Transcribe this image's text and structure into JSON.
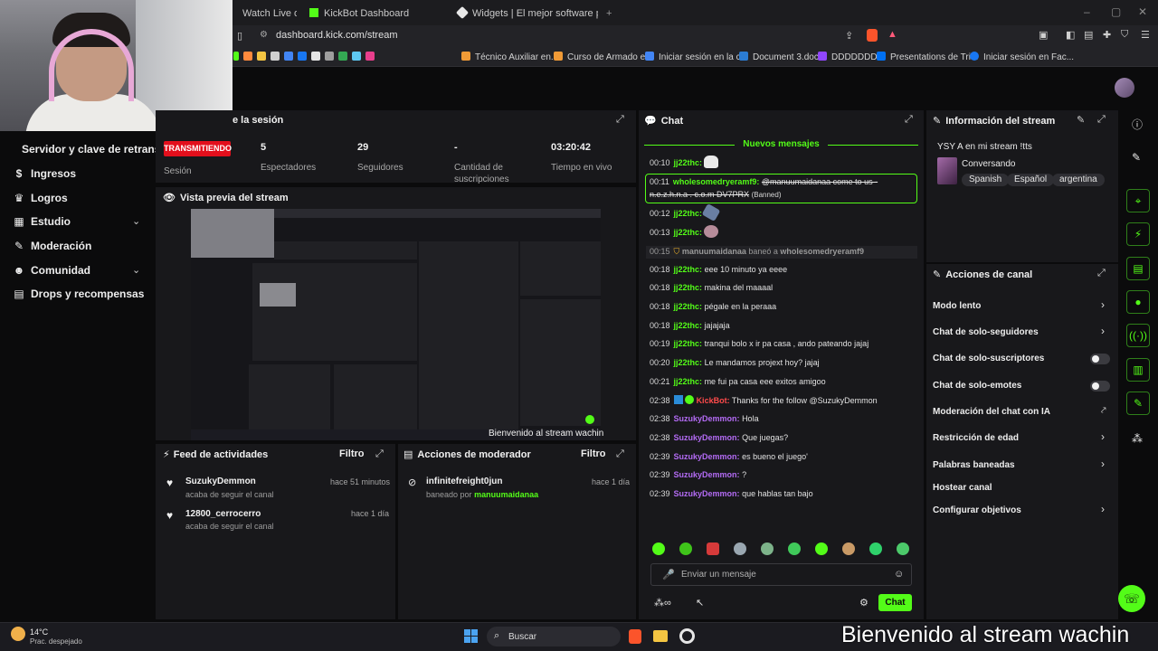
{
  "browser": {
    "tabs": [
      {
        "label": "Watch Live on"
      },
      {
        "label": "KickBot Dashboard"
      },
      {
        "label": "Widgets | El mejor software para pot"
      }
    ],
    "url": "dashboard.kick.com/stream",
    "bookmarks": [
      "Técnico Auxiliar en...",
      "Curso de Armado e...",
      "Iniciar sesión en la c...",
      "Document 3.docx",
      "DDDDDDD",
      "Presentations de Tri...",
      "Iniciar sesión en Fac..."
    ]
  },
  "sidebar": {
    "top_label": "Servidor y clave de retransm",
    "items": [
      {
        "label": "Ingresos",
        "icon": "dollar-icon"
      },
      {
        "label": "Logros",
        "icon": "trophy-icon"
      },
      {
        "label": "Estudio",
        "icon": "studio-icon"
      },
      {
        "label": "Moderación",
        "icon": "wrench-icon"
      },
      {
        "label": "Comunidad",
        "icon": "community-icon"
      },
      {
        "label": "Drops y recompensas",
        "icon": "drops-icon"
      }
    ]
  },
  "session": {
    "title": "e la sesión",
    "badge": "TRANSMITIENDO",
    "status_label": "Sesión",
    "stats": [
      {
        "value": "5",
        "label": "Espectadores"
      },
      {
        "value": "29",
        "label": "Seguidores"
      },
      {
        "value": "-",
        "label": "Cantidad de suscripciones"
      },
      {
        "value": "03:20:42",
        "label": "Tiempo en vivo"
      }
    ]
  },
  "preview": {
    "title": "Vista previa del stream",
    "caption": "Bienvenido al stream wachin"
  },
  "activity": {
    "title": "Feed de actividades",
    "filter": "Filtro",
    "items": [
      {
        "name": "SuzukyDemmon",
        "sub": "acaba de seguir el canal",
        "time": "hace 51 minutos"
      },
      {
        "name": "12800_cerrocerro",
        "sub": "acaba de seguir el canal",
        "time": "hace 1 día"
      }
    ]
  },
  "mod_actions": {
    "title": "Acciones de moderador",
    "filter": "Filtro",
    "items": [
      {
        "name": "infinitefreight0jun",
        "sub_prefix": "baneado por",
        "sub_user": "manuumaidanaa",
        "time": "hace 1 día"
      }
    ]
  },
  "chat": {
    "title": "Chat",
    "new_messages": "Nuevos mensajes",
    "banned_time": "00:11",
    "banned_user": "wholesomedryeramf9:",
    "banned_text_1": "@manuumaidanaa come to us -",
    "banned_text_2": "n.e.z.h.n.a . c.o.m DV7PRX",
    "banned_tag": "(Banned)",
    "ban_notice": {
      "time": "00:15",
      "mod": "manuumaidanaa",
      "action": "baneó a",
      "target": "wholesomedryeramf9"
    },
    "messages": [
      {
        "time": "00:10",
        "user": "jj22thc:",
        "text": "",
        "color": "green"
      },
      {
        "time": "00:12",
        "user": "jj22thc:",
        "text": "",
        "color": "green"
      },
      {
        "time": "00:13",
        "user": "jj22thc:",
        "text": "",
        "color": "green"
      },
      {
        "time": "00:18",
        "user": "jj22thc:",
        "text": "eee 10 minuto ya eeee",
        "color": "green"
      },
      {
        "time": "00:18",
        "user": "jj22thc:",
        "text": "makina del maaaal",
        "color": "green"
      },
      {
        "time": "00:18",
        "user": "jj22thc:",
        "text": "pégale en la peraaa",
        "color": "green"
      },
      {
        "time": "00:18",
        "user": "jj22thc:",
        "text": "jajajaja",
        "color": "green"
      },
      {
        "time": "00:19",
        "user": "jj22thc:",
        "text": "tranqui bolo x ir pa casa , ando pateando jajaj",
        "color": "green"
      },
      {
        "time": "00:20",
        "user": "jj22thc:",
        "text": "Le mandamos projext hoy? jajaj",
        "color": "green"
      },
      {
        "time": "00:21",
        "user": "jj22thc:",
        "text": "me fui pa casa eee exitos amigoo",
        "color": "green"
      },
      {
        "time": "02:38",
        "user": "KickBot:",
        "text": "Thanks for the follow @SuzukyDemmon",
        "color": "red"
      },
      {
        "time": "02:38",
        "user": "SuzukyDemmon:",
        "text": "Hola",
        "color": "purple"
      },
      {
        "time": "02:38",
        "user": "SuzukyDemmon:",
        "text": "Que juegas?",
        "color": "purple"
      },
      {
        "time": "02:39",
        "user": "SuzukyDemmon:",
        "text": "es bueno el juego'",
        "color": "purple"
      },
      {
        "time": "02:39",
        "user": "SuzukyDemmon:",
        "text": "?",
        "color": "purple"
      },
      {
        "time": "02:39",
        "user": "SuzukyDemmon:",
        "text": "que hablas tan bajo",
        "color": "purple"
      }
    ],
    "input_placeholder": "Enviar un mensaje",
    "send_label": "Chat"
  },
  "stream_info": {
    "title": "Información del stream",
    "stream_title": "YSY A en mi stream !tts",
    "category": "Conversando",
    "tags": [
      "Spanish",
      "Español",
      "argentina"
    ]
  },
  "channel_actions": {
    "title": "Acciones de canal",
    "items": [
      {
        "label": "Modo lento",
        "control": "chevron"
      },
      {
        "label": "Chat de solo-seguidores",
        "control": "chevron"
      },
      {
        "label": "Chat de solo-suscriptores",
        "control": "toggle"
      },
      {
        "label": "Chat de solo-emotes",
        "control": "toggle"
      },
      {
        "label": "Moderación del chat con IA",
        "control": "external"
      },
      {
        "label": "Restricción de edad",
        "control": "chevron"
      },
      {
        "label": "Palabras baneadas",
        "control": "chevron"
      },
      {
        "label": "Hostear canal",
        "control": "none"
      },
      {
        "label": "Configurar objetivos",
        "control": "chevron"
      }
    ]
  },
  "taskbar": {
    "temperature": "14°C",
    "weather": "Prac. despejado",
    "search": "Buscar"
  },
  "overlay_text": "Bienvenido al stream wachin",
  "colors": {
    "accent": "#53fc18",
    "live": "#e30f1c",
    "panel": "#18181b",
    "background": "#0b0b0c"
  }
}
